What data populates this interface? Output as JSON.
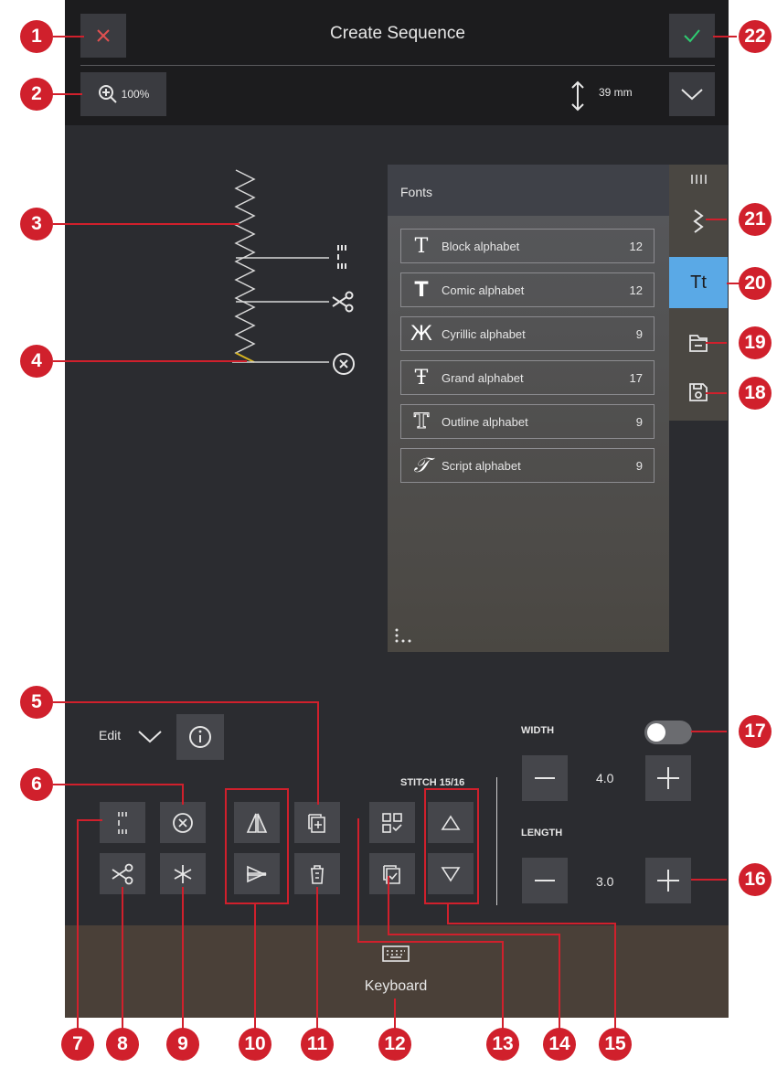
{
  "header": {
    "title": "Create Sequence",
    "zoom": "100%",
    "height_value": "39 mm"
  },
  "fonts_panel": {
    "title": "Fonts",
    "items": [
      {
        "icon": "T",
        "name": "Block alphabet",
        "count": "12"
      },
      {
        "icon": "T",
        "name": "Comic alphabet",
        "count": "12"
      },
      {
        "icon": "Ж",
        "name": "Cyrillic alphabet",
        "count": "9"
      },
      {
        "icon": "Ŧ",
        "name": "Grand alphabet",
        "count": "17"
      },
      {
        "icon": "T",
        "name": "Outline alphabet",
        "count": "9"
      },
      {
        "icon": "𝒯",
        "name": "Script alphabet",
        "count": "9"
      }
    ]
  },
  "side_tabs": {
    "fonts_tab": "Tt"
  },
  "edit": {
    "label": "Edit"
  },
  "stitch": {
    "label": "STITCH 15/16"
  },
  "width": {
    "label": "WIDTH",
    "value": "4.0"
  },
  "length": {
    "label": "LENGTH",
    "value": "3.0"
  },
  "bottom": {
    "keyboard_label": "Keyboard"
  },
  "callouts": [
    "1",
    "2",
    "3",
    "4",
    "5",
    "6",
    "7",
    "8",
    "9",
    "10",
    "11",
    "12",
    "13",
    "14",
    "15",
    "16",
    "17",
    "18",
    "19",
    "20",
    "21",
    "22"
  ],
  "colors": {
    "accent": "#5aa9e6",
    "callout": "#d0202c",
    "confirm": "#2ecc71",
    "cancel": "#e05050"
  }
}
